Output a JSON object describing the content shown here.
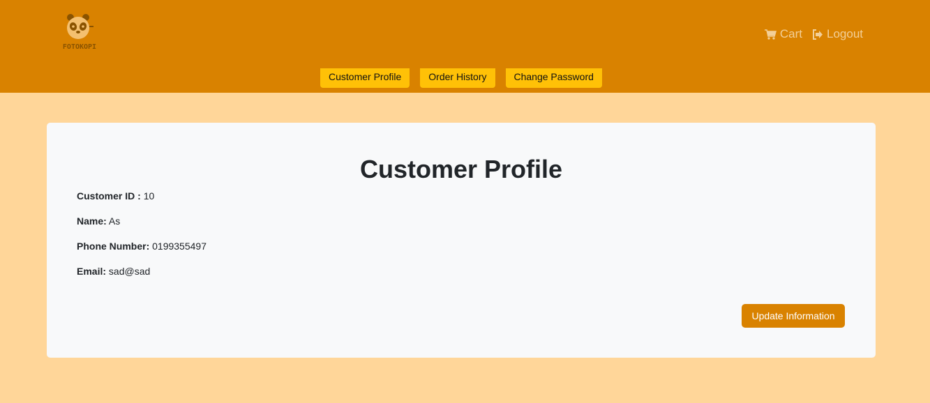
{
  "brand": {
    "name": "FOTOKOPI",
    "logo_icon": "panda-icon"
  },
  "top_nav": {
    "cart_label": "Cart",
    "cart_icon": "cart-icon",
    "logout_label": "Logout",
    "logout_icon": "logout-icon"
  },
  "tabs": [
    {
      "label": "Customer Profile"
    },
    {
      "label": "Order History"
    },
    {
      "label": "Change Password"
    }
  ],
  "profile": {
    "title": "Customer Profile",
    "fields": [
      {
        "label": "Customer ID :",
        "value": "10"
      },
      {
        "label": "Name:",
        "value": "As"
      },
      {
        "label": "Phone Number:",
        "value": "0199355497"
      },
      {
        "label": "Email:",
        "value": "sad@sad"
      }
    ],
    "update_button_label": "Update Information"
  },
  "colors": {
    "header_bg": "#d98200",
    "page_bg": "#ffd699",
    "tab_bg": "#ffc107",
    "card_bg": "#f8f9fa",
    "button_bg": "#d98200"
  }
}
